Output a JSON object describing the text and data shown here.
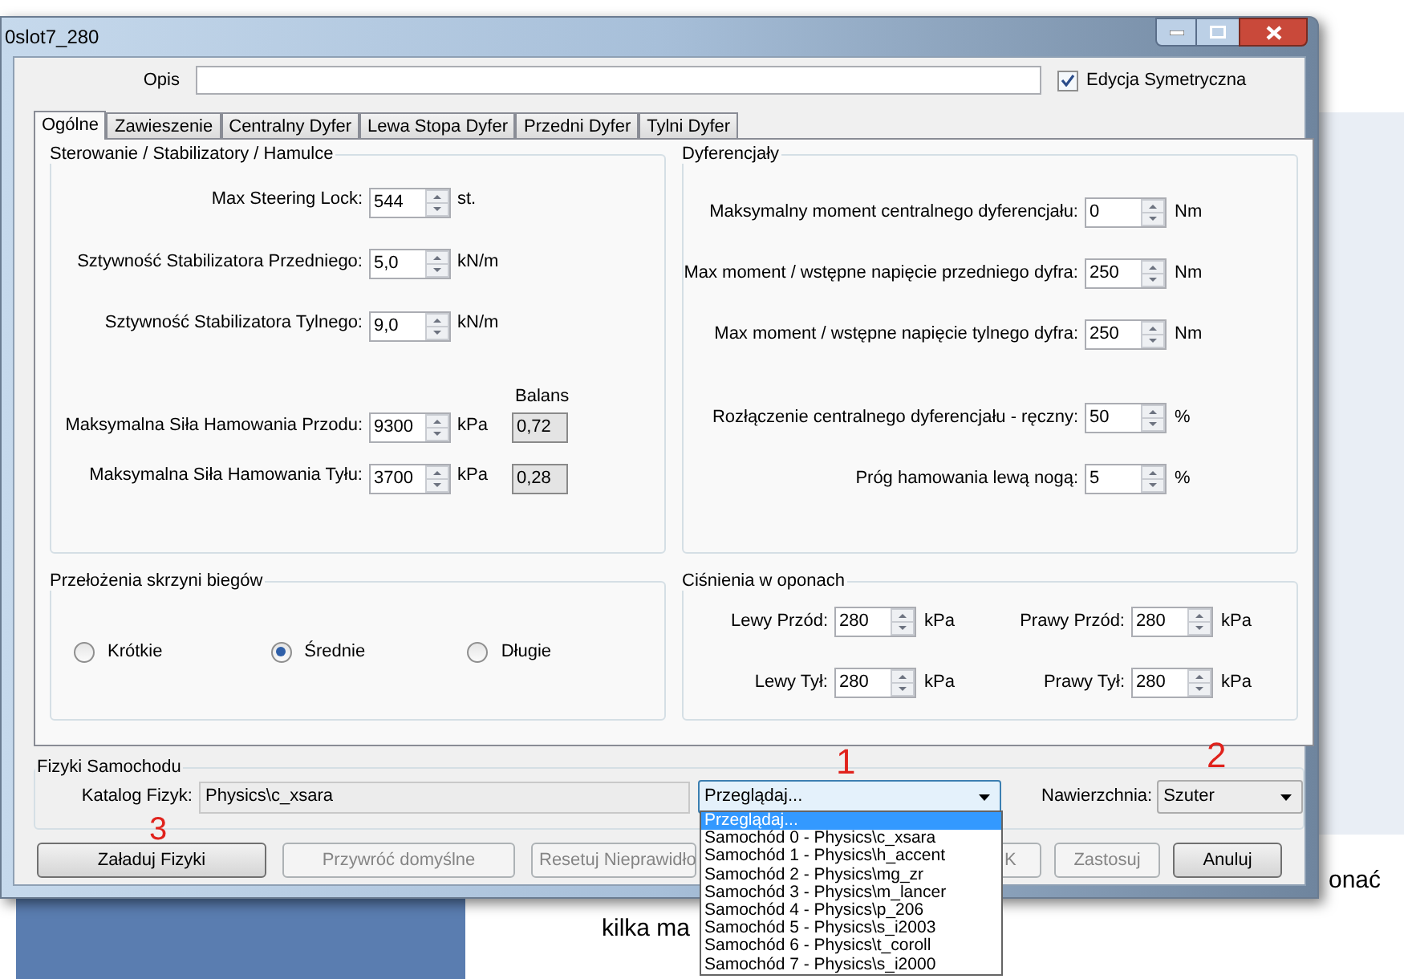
{
  "window": {
    "title": "0slot7_280"
  },
  "description": {
    "label": "Opis"
  },
  "symmetric_edit": {
    "label": "Edycja Symetryczna",
    "checked": true
  },
  "tabs": [
    {
      "label": "Ogólne",
      "selected": true
    },
    {
      "label": "Zawieszenie",
      "selected": false
    },
    {
      "label": "Centralny Dyfer",
      "selected": false
    },
    {
      "label": "Lewa Stopa Dyfer",
      "selected": false
    },
    {
      "label": "Przedni Dyfer",
      "selected": false
    },
    {
      "label": "Tylni Dyfer",
      "selected": false
    }
  ],
  "steering": {
    "title": "Sterowanie / Stabilizatory / Hamulce",
    "balance_header": "Balans",
    "rows": [
      {
        "label": "Max Steering Lock:",
        "value": "544",
        "unit": "st."
      },
      {
        "label": "Sztywność Stabilizatora Przedniego:",
        "value": "5,0",
        "unit": "kN/m"
      },
      {
        "label": "Sztywność Stabilizatora Tylnego:",
        "value": "9,0",
        "unit": "kN/m"
      },
      {
        "label": "Maksymalna Siła Hamowania Przodu:",
        "value": "9300",
        "unit": "kPa",
        "balance": "0,72"
      },
      {
        "label": "Maksymalna Siła Hamowania Tyłu:",
        "value": "3700",
        "unit": "kPa",
        "balance": "0,28"
      }
    ]
  },
  "differentials": {
    "title": "Dyferencjały",
    "rows": [
      {
        "label": "Maksymalny moment centralnego dyferencjału:",
        "value": "0",
        "unit": "Nm"
      },
      {
        "label": "Max moment / wstępne napięcie przedniego dyfra:",
        "value": "250",
        "unit": "Nm"
      },
      {
        "label": "Max moment / wstępne napięcie tylnego dyfra:",
        "value": "250",
        "unit": "Nm"
      },
      {
        "label": "Rozłączenie centralnego dyferencjału - ręczny:",
        "value": "50",
        "unit": "%"
      },
      {
        "label": "Próg hamowania lewą nogą:",
        "value": "5",
        "unit": "%"
      }
    ]
  },
  "gearbox": {
    "title": "Przełożenia skrzyni biegów",
    "options": [
      {
        "label": "Krótkie",
        "selected": false
      },
      {
        "label": "Średnie",
        "selected": true
      },
      {
        "label": "Długie",
        "selected": false
      }
    ]
  },
  "tires": {
    "title": "Ciśnienia w oponach",
    "fields": [
      {
        "label": "Lewy Przód:",
        "value": "280",
        "unit": "kPa"
      },
      {
        "label": "Prawy Przód:",
        "value": "280",
        "unit": "kPa"
      },
      {
        "label": "Lewy Tył:",
        "value": "280",
        "unit": "kPa"
      },
      {
        "label": "Prawy Tył:",
        "value": "280",
        "unit": "kPa"
      }
    ]
  },
  "physics": {
    "title": "Fizyki Samochodu",
    "catalog_label": "Katalog Fizyk:",
    "catalog_value": "Physics\\c_xsara",
    "browse": {
      "value": "Przeglądaj...",
      "expanded": true,
      "options": [
        {
          "label": "Przeglądaj...",
          "selected": true
        },
        {
          "label": "Samochód 0 - Physics\\c_xsara",
          "selected": false
        },
        {
          "label": "Samochód 1 - Physics\\h_accent",
          "selected": false
        },
        {
          "label": "Samochód 2 - Physics\\mg_zr",
          "selected": false
        },
        {
          "label": "Samochód 3 - Physics\\m_lancer",
          "selected": false
        },
        {
          "label": "Samochód 4 - Physics\\p_206",
          "selected": false
        },
        {
          "label": "Samochód 5 - Physics\\s_i2003",
          "selected": false
        },
        {
          "label": "Samochód 6 - Physics\\t_coroll",
          "selected": false
        },
        {
          "label": "Samochód 7 - Physics\\s_i2000",
          "selected": false
        }
      ]
    },
    "surface_label": "Nawierzchnia:",
    "surface_value": "Szuter"
  },
  "buttons": [
    {
      "label": "Załaduj Fizyki",
      "disabled": false
    },
    {
      "label": "Przywróć domyślne",
      "disabled": true
    },
    {
      "label": "Resetuj Nieprawidło",
      "disabled": true
    },
    {
      "label": "K",
      "disabled": true
    },
    {
      "label": "Zastosuj",
      "disabled": true
    },
    {
      "label": "Anuluj",
      "disabled": false
    }
  ],
  "annotations": [
    "1",
    "2",
    "3"
  ],
  "background": {
    "texts": [
      "kilka ma",
      "onać"
    ]
  }
}
